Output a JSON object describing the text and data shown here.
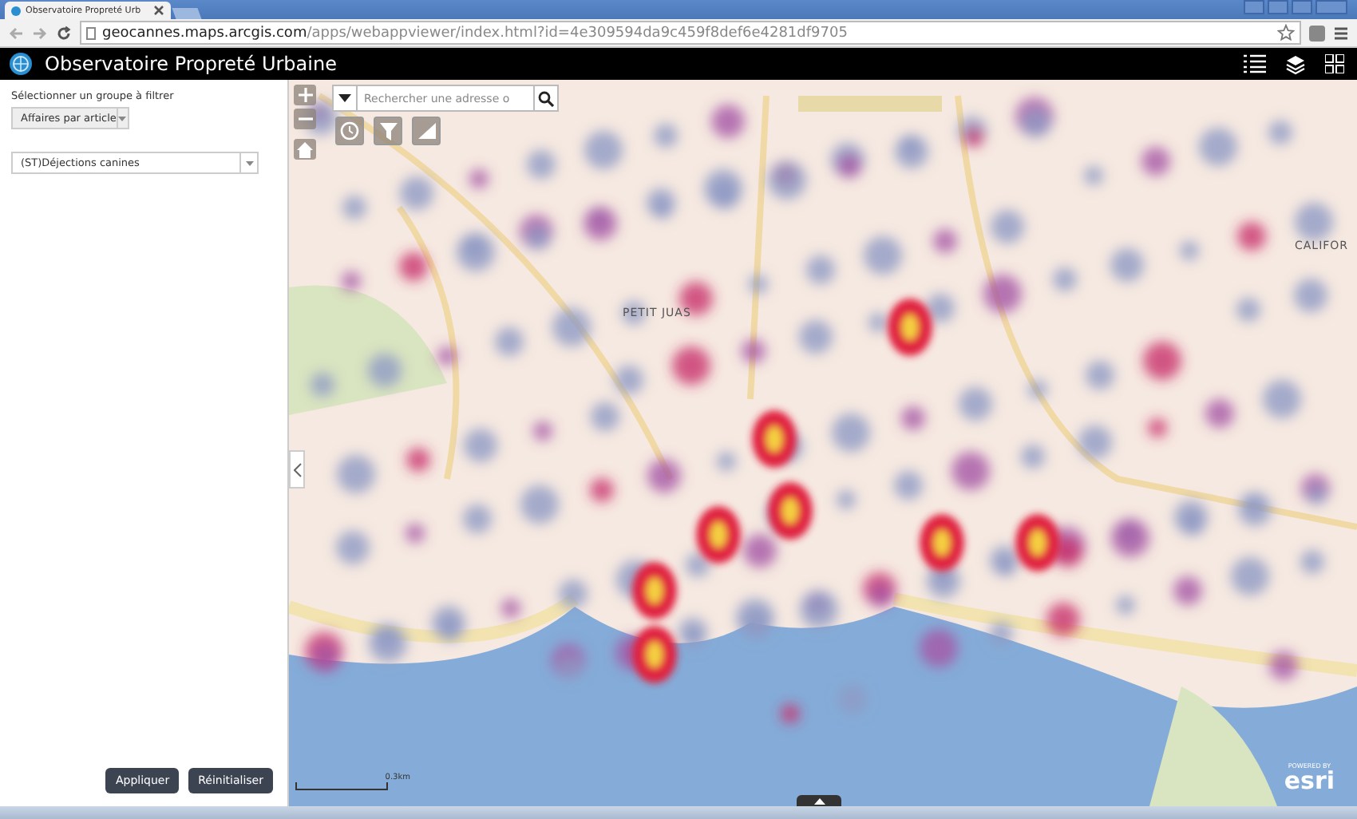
{
  "browser": {
    "tab_title": "Observatoire Propreté Urb",
    "url_host": "geocannes.maps.arcgis.com",
    "url_path": "/apps/webappviewer/index.html?id=4e309594da9c459f8def6e4281df9705"
  },
  "app": {
    "title": "Observatoire Propreté Urbaine"
  },
  "panel": {
    "group_label": "Sélectionner un groupe à filtrer",
    "group_value": "Affaires par article",
    "filter_value": "(ST)Déjections canines",
    "buttons": [
      "Appliquer",
      "Réinitialiser"
    ]
  },
  "map": {
    "search_placeholder": "Rechercher une adresse o",
    "labels": [
      {
        "text": "PETIT JUAS",
        "kind": "district"
      },
      {
        "text": "CALIFOR",
        "kind": "district"
      }
    ],
    "scale": "0.3km",
    "attribution_top": "POWERED BY",
    "attribution": "esri"
  }
}
